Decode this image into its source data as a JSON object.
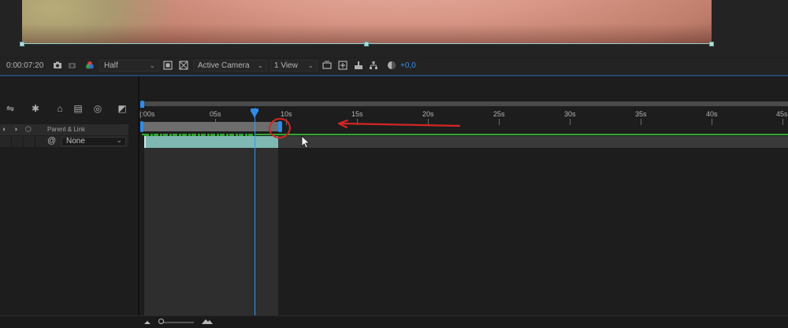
{
  "viewer": {
    "timecode": "0:00:07:20",
    "resolution": "Half",
    "camera": "Active Camera",
    "views": "1 View",
    "exposure": "+0,0"
  },
  "layer_panel": {
    "column_header": "Parent & Link",
    "parent_value": "None"
  },
  "ruler": {
    "labels": [
      "|:00s",
      "05s",
      "10s",
      "15s",
      "20s",
      "25s",
      "30s",
      "35s",
      "40s",
      "45s"
    ]
  },
  "colors": {
    "accent_blue": "#2d8ceb",
    "layer_bar": "#7fb8b2",
    "cache_green": "#33a833",
    "annotation_red": "#d42525"
  },
  "icons": [
    "camera-icon",
    "channel-icon",
    "grid-icon",
    "mask-icon",
    "switch-icon",
    "3d-icon",
    "comment-icon",
    "graph-icon",
    "exposure-reset-icon",
    "mountain-small-icon",
    "mountain-large-icon"
  ]
}
